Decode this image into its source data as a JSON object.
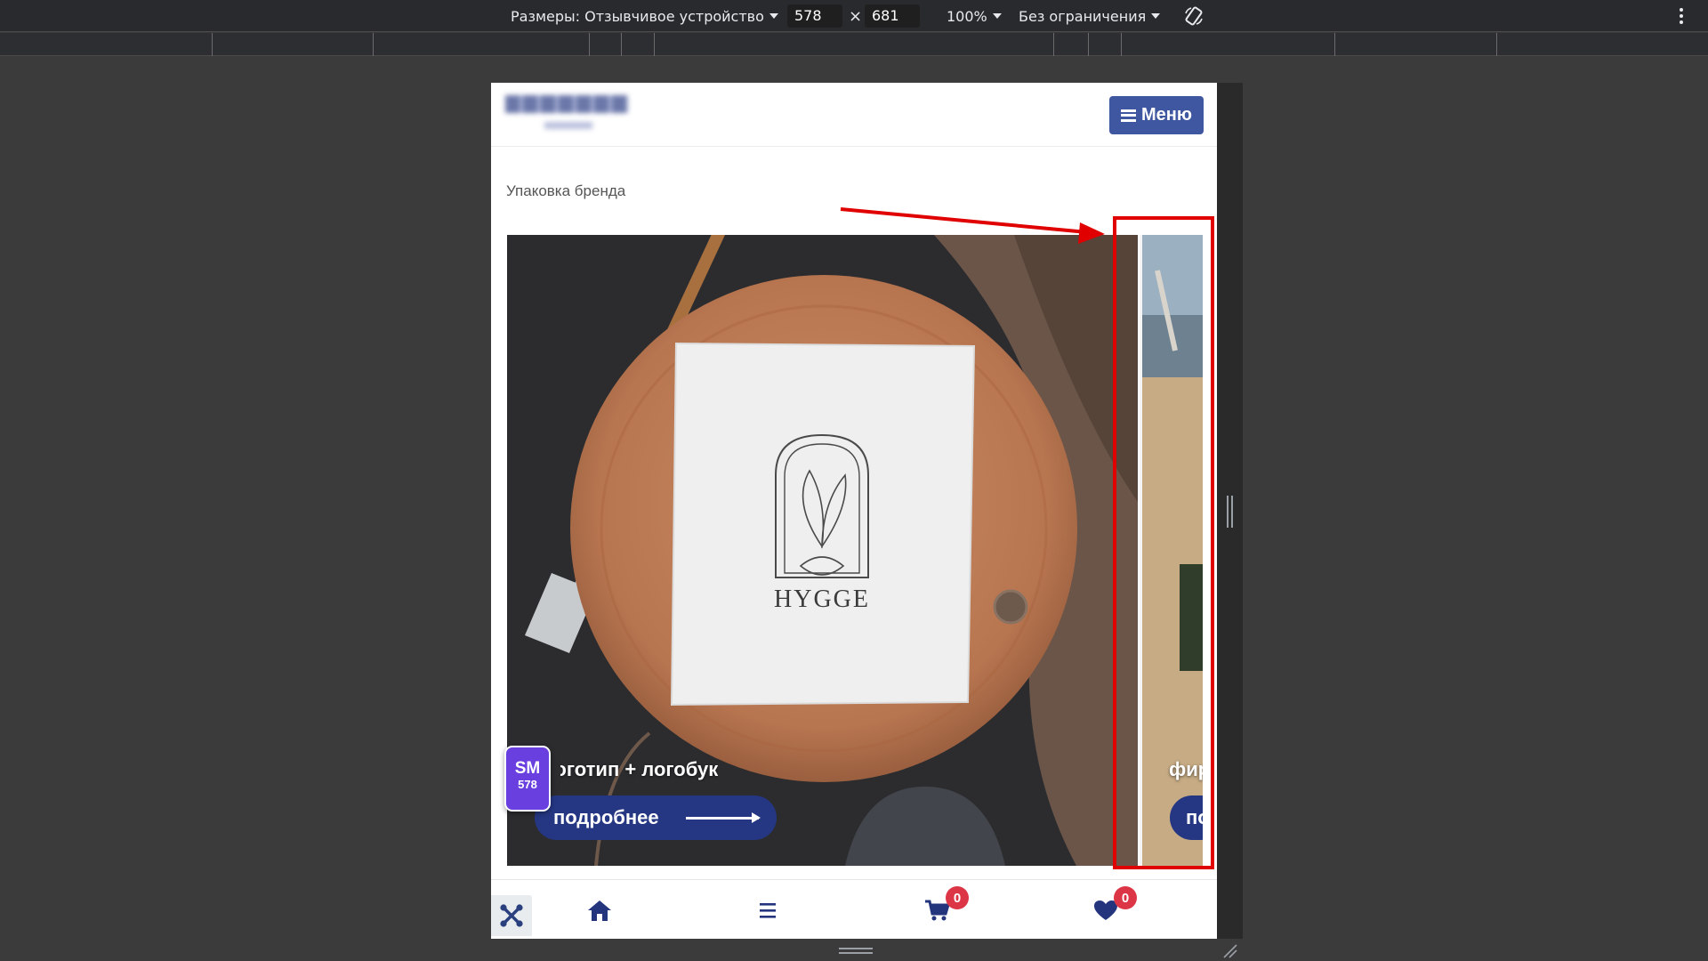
{
  "devtools": {
    "dimensions_label": "Размеры: Отзывчивое устройство",
    "width": "578",
    "height": "681",
    "times": "×",
    "zoom": "100%",
    "throttle": "Без ограничения"
  },
  "site": {
    "menu_label": "Меню",
    "category_title": "Упаковка бренда",
    "slides": [
      {
        "caption": "Логотип + логобук",
        "button": "подробнее",
        "image_text": "HYGGE"
      },
      {
        "caption": "фирменный стиль",
        "button": "подробнее"
      }
    ],
    "sm_badge": {
      "line1": "SM",
      "line2": "578"
    },
    "bottom_nav": {
      "cart_count": "0",
      "wishlist_count": "0"
    }
  },
  "colors": {
    "accent": "#3f56a0",
    "button_dark": "#253783",
    "badge_red": "#dc3545",
    "annotation": "#e00000",
    "sm_badge": "#6a3fe0"
  }
}
